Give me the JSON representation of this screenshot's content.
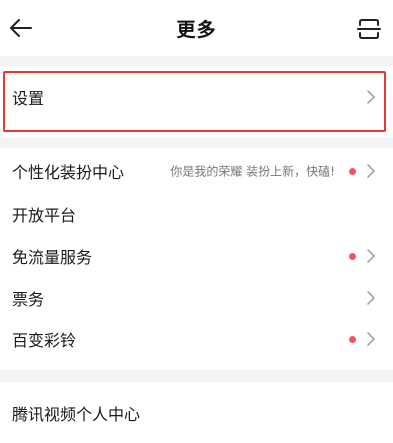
{
  "header": {
    "title": "更多",
    "back_icon": "arrow-left-icon",
    "scan_icon": "scan-icon"
  },
  "settings": {
    "label": "设置"
  },
  "menu": {
    "items": [
      {
        "label": "个性化装扮中心",
        "desc": "你是我的荣耀 装扮上新，快磕!",
        "dot": true,
        "chevron": true
      },
      {
        "label": "开放平台",
        "desc": "",
        "dot": false,
        "chevron": false
      },
      {
        "label": "免流量服务",
        "desc": "",
        "dot": true,
        "chevron": true
      },
      {
        "label": "票务",
        "desc": "",
        "dot": false,
        "chevron": true
      },
      {
        "label": "百变彩铃",
        "desc": "",
        "dot": true,
        "chevron": true
      }
    ]
  },
  "personal_center": {
    "label": "腾讯视频个人中心"
  },
  "colors": {
    "dot": "#f2555a",
    "highlight": "#e53935",
    "divider_bg": "#f4f4f5"
  }
}
